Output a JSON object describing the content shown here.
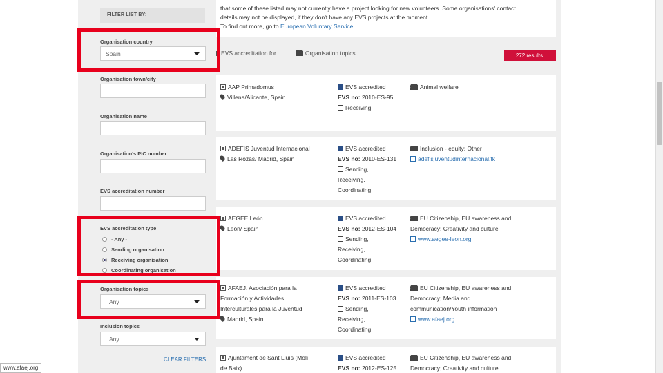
{
  "sidebar": {
    "header": "FILTER LIST BY:",
    "country_label": "Organisation country",
    "country_value": "Spain",
    "town_label": "Organisation town/city",
    "name_label": "Organisation name",
    "pic_label": "Organisation's PIC number",
    "evs_number_label": "EVS accreditation number",
    "accreditation_type_label": "EVS accreditation type",
    "accreditation_options": [
      {
        "label": "- Any -",
        "selected": false
      },
      {
        "label": "Sending organisation",
        "selected": false
      },
      {
        "label": "Receiving organisation",
        "selected": true
      },
      {
        "label": "Coordinating organisation",
        "selected": false
      }
    ],
    "topics_label": "Organisation topics",
    "topics_value": "Any",
    "inclusion_label": "Inclusion topics",
    "inclusion_value": "Any",
    "clear_filters": "CLEAR FILTERS"
  },
  "intro": {
    "line1": "that some of these listed may not currently have a project looking for new volunteers. Some organisations' contact",
    "line2": "details may not be displayed, if they don't have any EVS projects at the moment.",
    "line3_prefix": "To find out more, go to",
    "line3_link": "European Voluntary Service",
    "line3_suffix": "."
  },
  "sortbar": {
    "accredited_for": "EVS accreditation for",
    "topics": "Organisation topics"
  },
  "results_badge": "272 results.",
  "organisations": [
    {
      "name_lines": [
        "AAP Primadomus"
      ],
      "location": "Villena/Alicante, Spain",
      "accredited": "EVS accredited",
      "evs_label": "EVS no:",
      "evs_no": "2010-ES-95",
      "roles": [
        "Receiving"
      ],
      "topics": [
        "Animal welfare"
      ],
      "website": ""
    },
    {
      "name_lines": [
        "ADEFIS Juventud Internacional"
      ],
      "location": "Las Rozas/ Madrid, Spain",
      "accredited": "EVS accredited",
      "evs_label": "EVS no:",
      "evs_no": "2010-ES-131",
      "roles": [
        "Sending,",
        "Receiving,",
        "Coordinating"
      ],
      "topics": [
        "Inclusion - equity; Other"
      ],
      "website": "adefisjuventudinternacional.tk"
    },
    {
      "name_lines": [
        "AEGEE León"
      ],
      "location": "León/ Spain",
      "accredited": "EVS accredited",
      "evs_label": "EVS no:",
      "evs_no": "2012-ES-104",
      "roles": [
        "Sending,",
        "Receiving,",
        "Coordinating"
      ],
      "topics": [
        "EU Citizenship, EU awareness and",
        "Democracy; Creativity and culture"
      ],
      "website": "www.aegee-leon.org"
    },
    {
      "name_lines": [
        "AFAEJ. Asociación para la",
        "Formación y Actividades",
        "Interculturales para la Juventud"
      ],
      "location": "Madrid, Spain",
      "accredited": "EVS accredited",
      "evs_label": "EVS no:",
      "evs_no": "2011-ES-103",
      "roles": [
        "Sending,",
        "Receiving,",
        "Coordinating"
      ],
      "topics": [
        "EU Citizenship, EU awareness and",
        "Democracy; Media and",
        "communication/Youth information"
      ],
      "website": "www.afaej.org"
    },
    {
      "name_lines": [
        "Ajuntament de Sant Lluís (Molí",
        "de Baix)"
      ],
      "location": "",
      "accredited": "EVS accredited",
      "evs_label": "EVS no:",
      "evs_no": "2012-ES-125",
      "roles": [],
      "topics": [
        "EU Citizenship, EU awareness and",
        "Democracy; Creativity and culture"
      ],
      "website": ""
    }
  ],
  "statusbar": "www.afaej.org",
  "colors": {
    "highlight": "#e8001c",
    "badge": "#d0103a",
    "link": "#2a6fb0"
  }
}
